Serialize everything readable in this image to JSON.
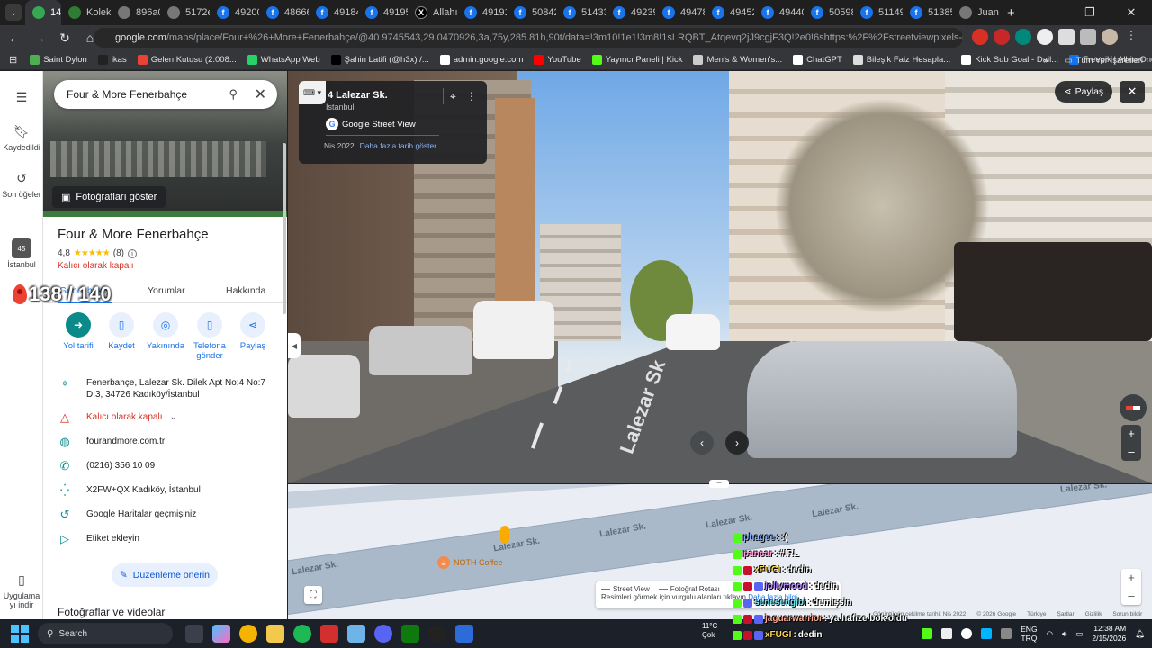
{
  "browser": {
    "tabs": [
      {
        "label": "14",
        "fav": "maps"
      },
      {
        "label": "Koleks",
        "fav": "green"
      },
      {
        "label": "896a0",
        "fav": "gray"
      },
      {
        "label": "5172e",
        "fav": "gray"
      },
      {
        "label": "49200",
        "fav": "blue"
      },
      {
        "label": "48666",
        "fav": "blue"
      },
      {
        "label": "49184",
        "fav": "blue"
      },
      {
        "label": "49195",
        "fav": "blue"
      },
      {
        "label": "Allahın",
        "fav": "x"
      },
      {
        "label": "49191",
        "fav": "blue"
      },
      {
        "label": "50842",
        "fav": "blue"
      },
      {
        "label": "51433",
        "fav": "blue"
      },
      {
        "label": "49239",
        "fav": "blue"
      },
      {
        "label": "49478",
        "fav": "blue"
      },
      {
        "label": "49452",
        "fav": "blue"
      },
      {
        "label": "49440",
        "fav": "blue"
      },
      {
        "label": "50598",
        "fav": "blue"
      },
      {
        "label": "51149",
        "fav": "blue"
      },
      {
        "label": "51385",
        "fav": "blue"
      },
      {
        "label": "Juan V",
        "fav": "gray"
      }
    ],
    "url_host": "google.com",
    "url_path": "/maps/place/Four+%26+More+Fenerbahçe/@40.9745543,29.0470926,3a,75y,285.81h,90t/data=!3m10!1e1!3m8!1sLRQBT_Atqevq2jJ9cgjF3Q!2e0!6shttps:%2F%2Fstreetviewpixels-pa.googleapis.com%2Fv..."
  },
  "bookmarks": [
    {
      "label": "Saint Dylon",
      "color": "#4caf50"
    },
    {
      "label": "ikas",
      "color": "#222"
    },
    {
      "label": "Gelen Kutusu (2.008...",
      "color": "#ea4335"
    },
    {
      "label": "WhatsApp Web",
      "color": "#25d366"
    },
    {
      "label": "Şahin Latifi (@h3x) /...",
      "color": "#000"
    },
    {
      "label": "admin.google.com",
      "color": "#fff"
    },
    {
      "label": "YouTube",
      "color": "#ff0000"
    },
    {
      "label": "Yayıncı Paneli | Kick",
      "color": "#53fc18"
    },
    {
      "label": "Men's & Women's...",
      "color": "#ccc"
    },
    {
      "label": "ChatGPT",
      "color": "#fff"
    },
    {
      "label": "Bileşik Faiz Hesapla...",
      "color": "#ddd"
    },
    {
      "label": "Kick Sub Goal - Dail...",
      "color": "#fff"
    },
    {
      "label": "Freepik | All-in-One...",
      "color": "#1273eb"
    }
  ],
  "bookmarks_all": "Tüm Yer İşaretleri",
  "rail": {
    "saved": "Kaydedildi",
    "recent": "Son öğeler",
    "istanbul": "İstanbul",
    "app": "Uygulama yı indir"
  },
  "panel": {
    "search_value": "Four & More Fenerbahçe",
    "show_photos": "Fotoğrafları göster",
    "title": "Four & More Fenerbahçe",
    "rating": "4,8",
    "stars": "★★★★★",
    "review_count": "(8)",
    "status": "Kalıcı olarak kapalı",
    "tabs": [
      "Genel bakış",
      "Yorumlar",
      "Hakkında"
    ],
    "actions": [
      "Yol tarifi",
      "Kaydet",
      "Yakınında",
      "Telefona gönder",
      "Paylaş"
    ],
    "address": "Fenerbahçe, Lalezar Sk. Dilek Apt No:4 No:7 D:3, 34726 Kadıköy/İstanbul",
    "closed_row": "Kalıcı olarak kapalı",
    "website": "fourandmore.com.tr",
    "phone": "(0216) 356 10 09",
    "plus_code": "X2FW+QX Kadıköy, İstanbul",
    "history": "Google Haritalar geçmişiniz",
    "label": "Etiket ekleyin",
    "suggest": "Düzenleme önerin",
    "photos_videos": "Fotoğraflar ve videolar"
  },
  "overlay_counter": "138 / 140",
  "streetview": {
    "title": "4 Lalezar Sk.",
    "city": "İstanbul",
    "brand": "Google Street View",
    "date": "Nis 2022",
    "more_dates": "Daha fazla tarih göster",
    "share": "Paylaş",
    "road_text": "Lalezar Sk"
  },
  "map": {
    "labels": [
      "Lalezar Sk.",
      "Lalezar Sk.",
      "Lalezar Sk.",
      "Lalezar Sk.",
      "Lalezar Sk.",
      "Lalezar Sk."
    ],
    "poi": "NOTH Coffee",
    "legend_sv": "Street View",
    "legend_photo": "Fotoğraf Rotası",
    "legend_hint": "Resimleri görmek için vurgulu alanları tıklayın",
    "legend_more": "Daha fazla bilgi"
  },
  "footer": [
    "Görüntünün çekilme tarihi: Nis 2022",
    "© 2026 Google",
    "Türkiye",
    "Şartlar",
    "Gizlilik",
    "Sorun bildir"
  ],
  "chat": [
    {
      "user": "phagee",
      "msg": ":(",
      "color": "#8ab4f8"
    },
    {
      "user": "pancar",
      "msg": "#IRL",
      "color": "#ff9ad5"
    },
    {
      "user": "xFUGI",
      "msg": "dedin",
      "color": "#ffd54f"
    },
    {
      "user": "jollymood",
      "msg": "dedin",
      "color": "#b388ff"
    },
    {
      "user": "senesengibi",
      "msg": "demişsin",
      "color": "#80deea"
    },
    {
      "user": "jaguarwarrior",
      "msg": "ya hafize bok oldu",
      "color": "#ffab91"
    },
    {
      "user": "xFUGI",
      "msg": "dedin",
      "color": "#ffd54f"
    }
  ],
  "taskbar": {
    "search": "Search",
    "weather_temp": "11°C",
    "weather_text": "Çok",
    "lang": "ENG",
    "lang2": "TRQ",
    "time": "12:38 AM",
    "date": "2/15/2026"
  }
}
